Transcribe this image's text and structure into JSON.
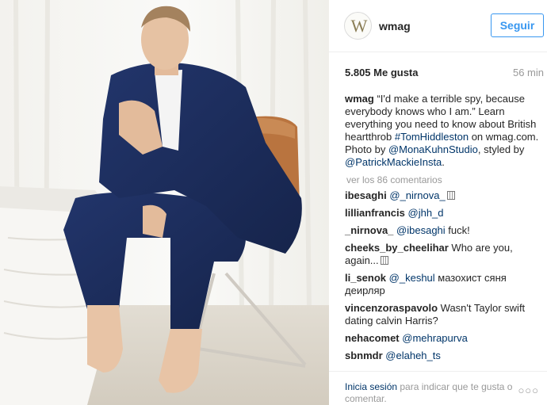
{
  "header": {
    "avatar_letter": "W",
    "username": "wmag",
    "follow_label": "Seguir"
  },
  "stats": {
    "likes": "5.805 Me gusta",
    "time": "56 min"
  },
  "caption": {
    "username": "wmag",
    "text_1": " “I'd make a terrible spy, because everybody knows who I am.” Learn everything you need to know about British heartthrob ",
    "hashtag": "#TomHiddleston",
    "text_2": " on wmag.com. Photo by ",
    "mention_1": "@MonaKuhnStudio",
    "text_3": ", styled by ",
    "mention_2": "@PatrickMackieInsta",
    "text_4": "."
  },
  "view_all_comments": "ver los 86 comentarios",
  "comments": [
    {
      "user": "ibesaghi",
      "mention": "@_nirnova_",
      "text": ""
    },
    {
      "user": "lillianfrancis",
      "mention": "@jhh_d",
      "text": ""
    },
    {
      "user": "_nirnova_",
      "mention": "@ibesaghi",
      "text": " fuck!"
    },
    {
      "user": "cheeks_by_cheelihar",
      "mention": "",
      "text": " Who are you, again..."
    },
    {
      "user": "li_senok",
      "mention": "@_keshul",
      "text": " мазохист сяня деирляр"
    },
    {
      "user": "vincenzoraspavolo",
      "mention": "",
      "text": " Wasn't Taylor swift dating calvin Harris?"
    },
    {
      "user": "nehacomet",
      "mention": "@mehrapurva",
      "text": ""
    },
    {
      "user": "sbnmdr",
      "mention": "@elaheh_ts",
      "text": ""
    }
  ],
  "footer": {
    "login_label": "Inicia sesión",
    "rest": " para indicar que te gusta o comentar.",
    "more_label": "○○○"
  },
  "colors": {
    "accent": "#3897f0",
    "link": "#003569",
    "muted": "#999999",
    "suit": "#1d2d5c",
    "chair": "#b9743f"
  }
}
